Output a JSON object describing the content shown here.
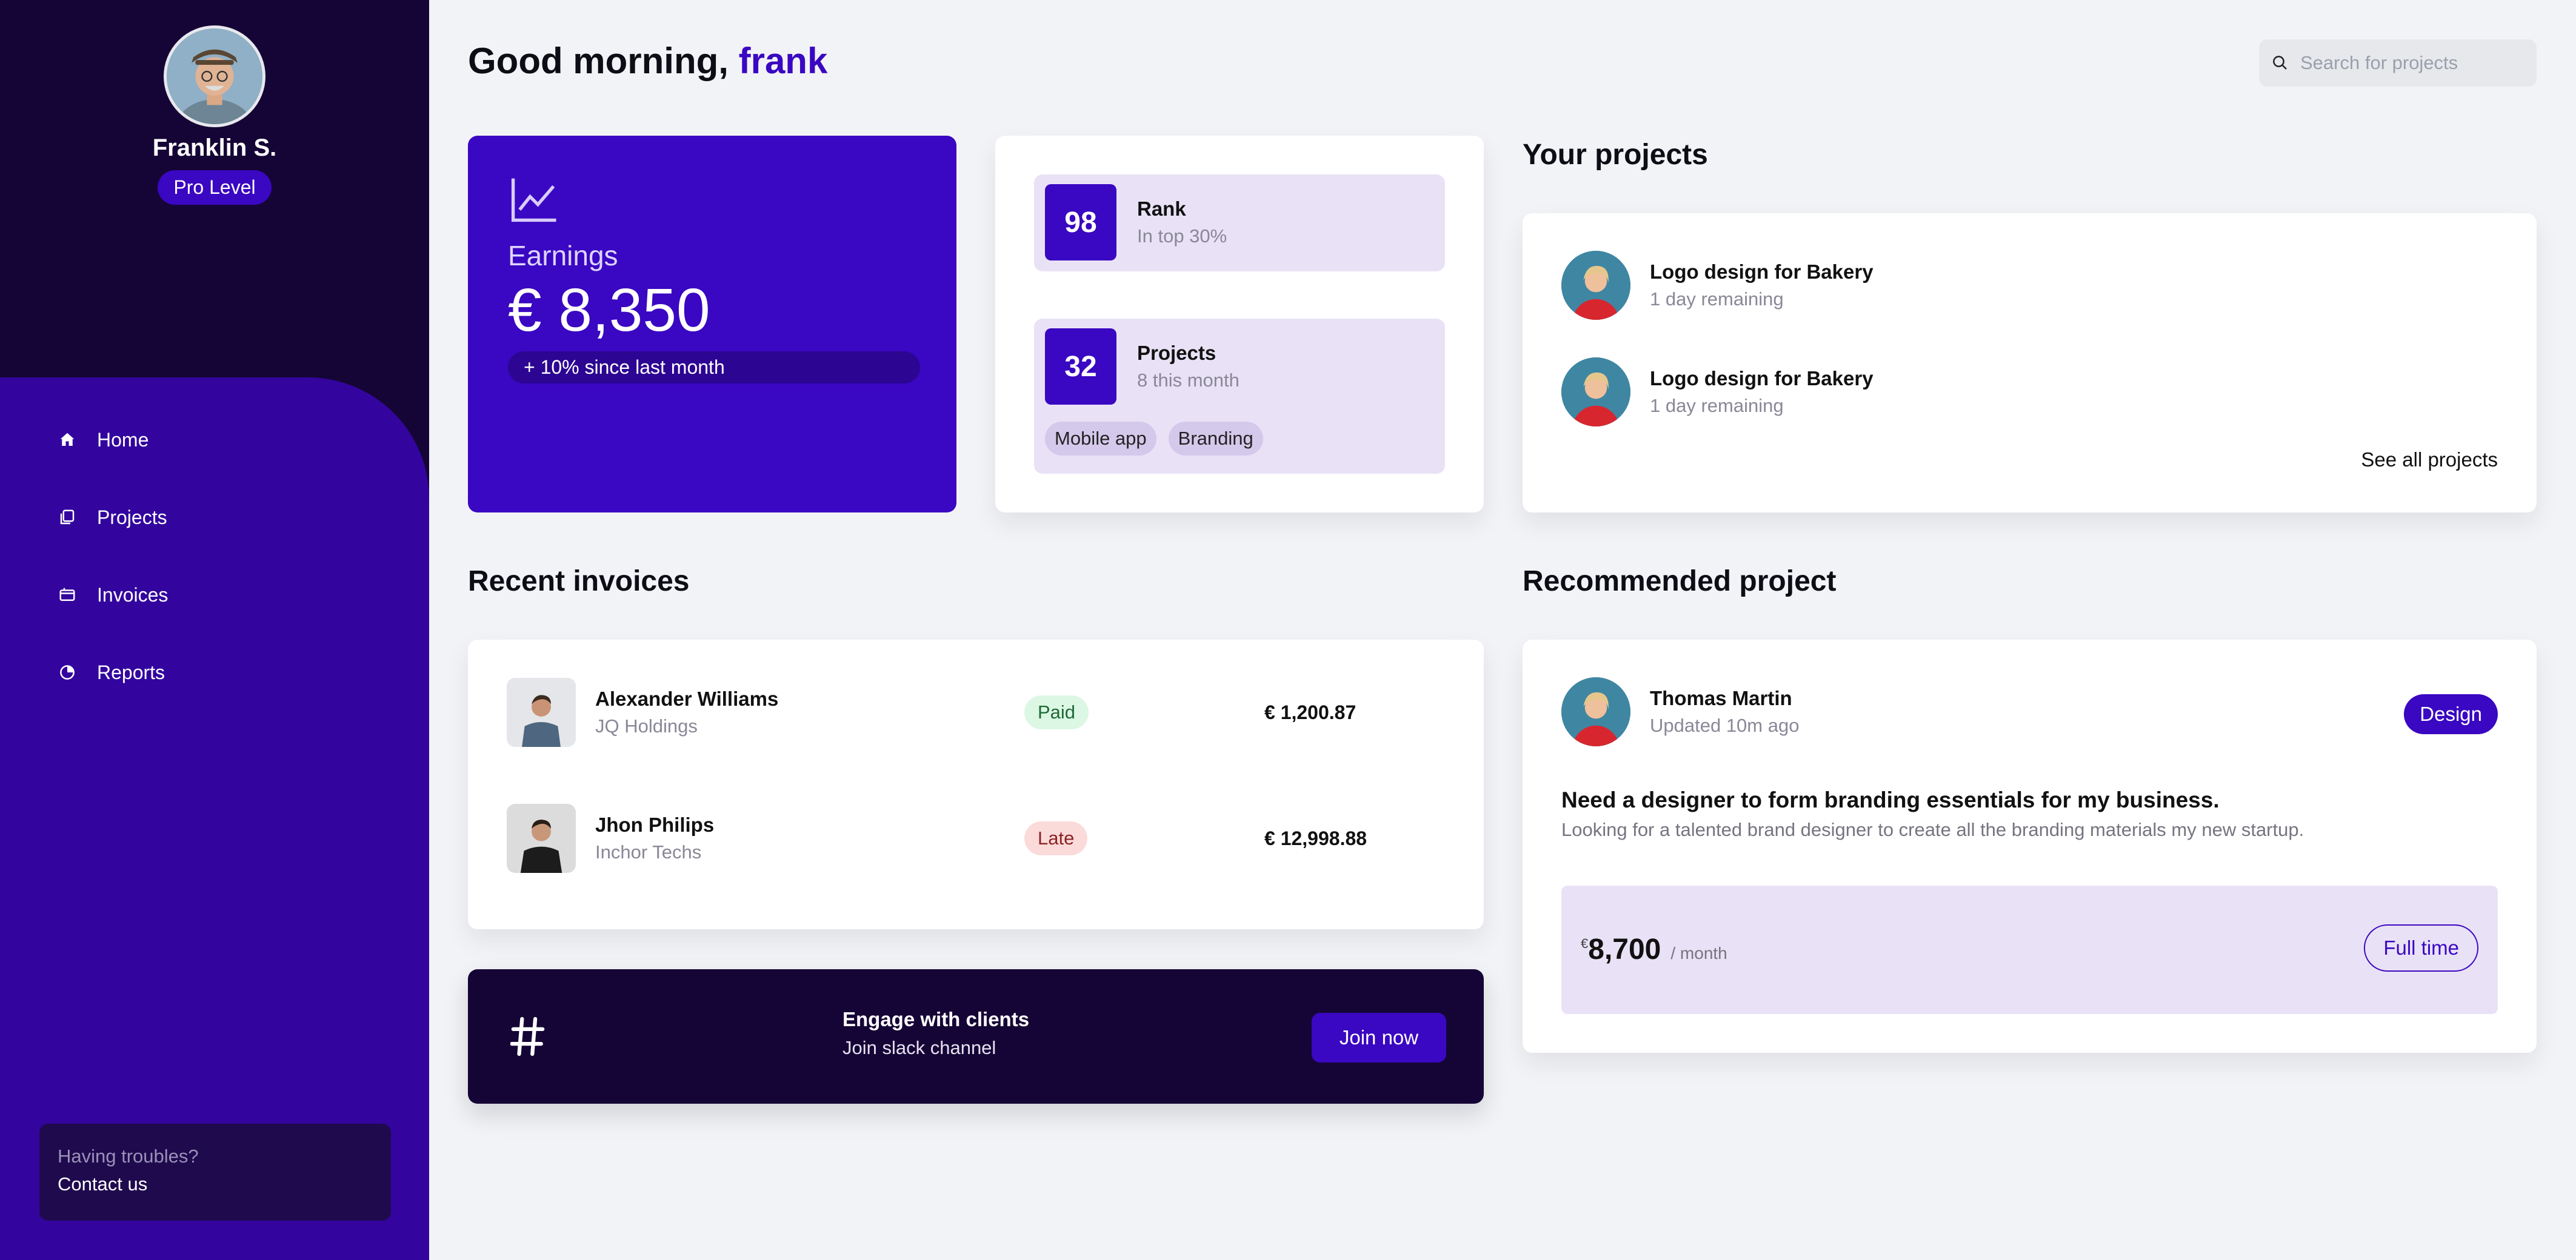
{
  "colors": {
    "accent": "#3a07c2",
    "sidebar_dark": "#150536",
    "sidebar_purple": "#33059e",
    "background": "#f2f3f6"
  },
  "profile": {
    "name": "Franklin S.",
    "level": "Pro Level"
  },
  "nav": [
    {
      "label": "Home",
      "icon": "home-icon"
    },
    {
      "label": "Projects",
      "icon": "projects-icon"
    },
    {
      "label": "Invoices",
      "icon": "invoices-icon"
    },
    {
      "label": "Reports",
      "icon": "reports-icon"
    }
  ],
  "help": {
    "question": "Having troubles?",
    "link": "Contact us"
  },
  "header": {
    "greeting": "Good morning,",
    "user": "frank"
  },
  "search": {
    "placeholder": "Search for projects",
    "icon": "search-icon"
  },
  "earnings": {
    "icon": "line-chart-icon",
    "label": "Earnings",
    "value": "€ 8,350",
    "delta": "+ 10% since last month"
  },
  "stats": {
    "rank": {
      "number": "98",
      "title": "Rank",
      "subtitle": "In top 30%"
    },
    "projects": {
      "number": "32",
      "title": "Projects",
      "subtitle": "8 this month",
      "tags": [
        "Mobile app",
        "Branding"
      ]
    }
  },
  "your_projects": {
    "title": "Your projects",
    "items": [
      {
        "title": "Logo design for Bakery",
        "subtitle": "1 day remaining"
      },
      {
        "title": "Logo design for Bakery",
        "subtitle": "1 day remaining"
      }
    ],
    "see_all": "See all projects"
  },
  "invoices": {
    "title": "Recent invoices",
    "rows": [
      {
        "name": "Alexander Williams",
        "company": "JQ Holdings",
        "status": "Paid",
        "amount": "€ 1,200.87"
      },
      {
        "name": "Jhon Philips",
        "company": "Inchor Techs",
        "status": "Late",
        "amount": "€ 12,998.88"
      }
    ]
  },
  "engage": {
    "icon": "hashtag-icon",
    "title": "Engage with clients",
    "subtitle": "Join slack channel",
    "button": "Join now"
  },
  "recommended": {
    "title": "Recommended project",
    "person": "Thomas Martin",
    "updated": "Updated 10m ago",
    "tag": "Design",
    "project_title": "Need a designer to form branding essentials for my business.",
    "description": "Looking for a talented brand designer to create all the branding materials my new startup.",
    "currency": "€",
    "amount": "8,700",
    "period": "/ month",
    "type": "Full time"
  }
}
